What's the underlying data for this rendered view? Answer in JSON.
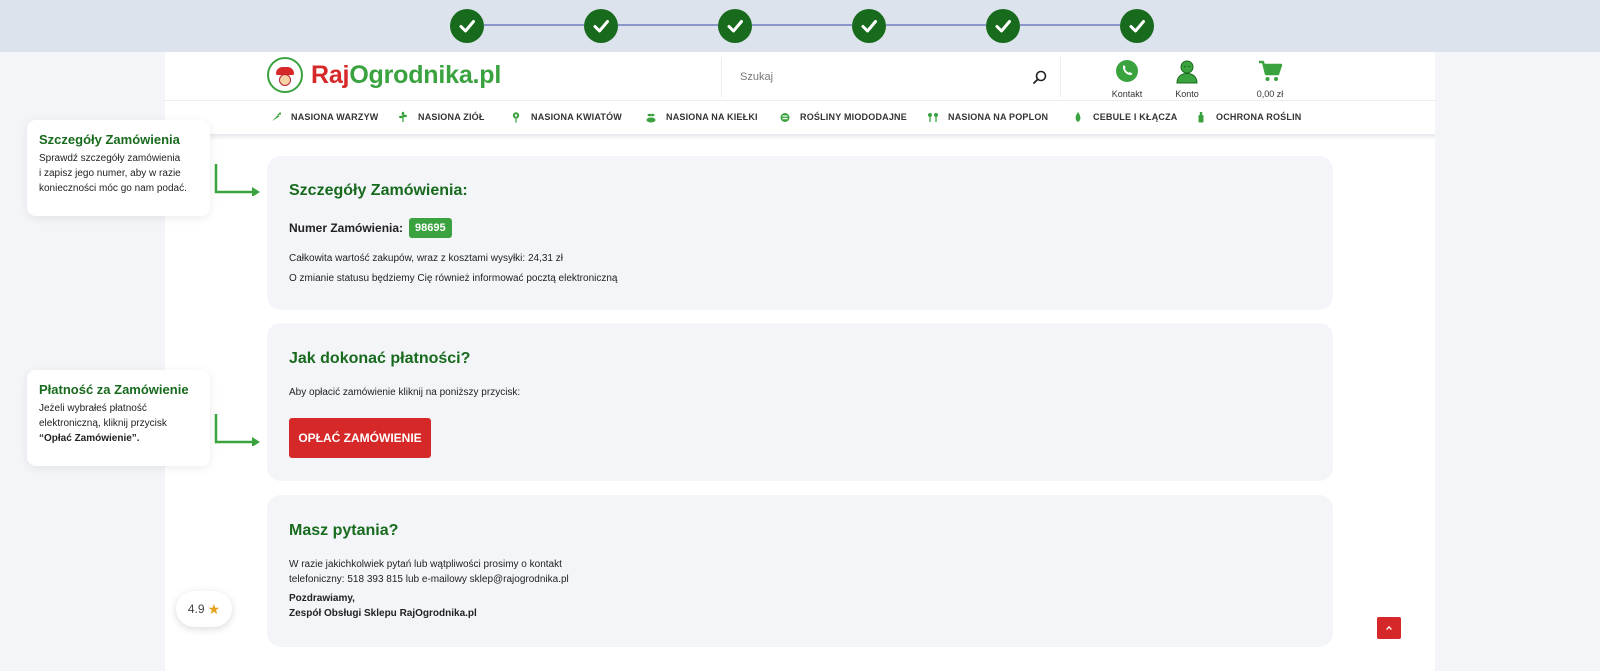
{
  "progress": {
    "steps_completed": 6,
    "steps_total": 6
  },
  "header": {
    "logo": {
      "part_a": "Raj",
      "part_b": "Ogrodnika.pl"
    },
    "search": {
      "placeholder": "Szukaj"
    },
    "contact_label": "Kontakt",
    "account_label": "Konto",
    "cart_total": "0,00 zł"
  },
  "nav": {
    "items": [
      {
        "label": "NASIONA WARZYW",
        "icon": "carrot-icon"
      },
      {
        "label": "NASIONA ZIÓŁ",
        "icon": "herb-icon"
      },
      {
        "label": "NASIONA KWIATÓW",
        "icon": "flower-icon"
      },
      {
        "label": "NASIONA NA KIEŁKI",
        "icon": "sprout-icon"
      },
      {
        "label": "ROŚLINY MIODODAJNE",
        "icon": "bee-plant-icon"
      },
      {
        "label": "NASIONA NA POPLON",
        "icon": "cover-crop-icon"
      },
      {
        "label": "CEBULE I KŁĄCZA",
        "icon": "bulb-icon"
      },
      {
        "label": "OCHRONA ROŚLIN",
        "icon": "spray-bottle-icon"
      }
    ]
  },
  "notes": {
    "details": {
      "title": "Szczegóły Zamówienia",
      "line1": "Sprawdź szczegóły zamówienia",
      "line2": "i zapisz jego numer, aby w razie",
      "line3": "konieczności móc go nam podać."
    },
    "payment": {
      "title": "Płatność za Zamówienie",
      "line1": "Jeżeli wybrałeś płatność",
      "line2": "elektroniczną, kliknij przycisk",
      "line3": "“Opłać Zamówienie”."
    }
  },
  "order_card": {
    "title": "Szczegóły Zamówienia:",
    "number_label": "Numer Zamówienia:",
    "number": "98695",
    "total_text": "Całkowita wartość zakupów, wraz z kosztami wysyłki: 24,31 zł",
    "status_text": "O zmianie statusu będziemy Cię również informować pocztą elektroniczną"
  },
  "payment_card": {
    "title": "Jak dokonać płatności?",
    "instruction": "Aby opłacić zamówienie kliknij na poniższy przycisk:",
    "button_label": "OPŁAĆ ZAMÓWIENIE"
  },
  "questions_card": {
    "title": "Masz pytania?",
    "line1": "W razie jakichkolwiek pytań lub wątpliwości prosimy o kontakt",
    "line2": "telefoniczny: 518 393 815 lub e-mailowy sklep@rajogrodnika.pl",
    "regards": "Pozdrawiamy,",
    "team": "Zespół Obsługi Sklepu RajOgrodnika.pl"
  },
  "rating": {
    "value": "4.9"
  },
  "colors": {
    "brand_green": "#186a1d",
    "accent_green": "#3aa33f",
    "accent_red": "#d62828"
  }
}
